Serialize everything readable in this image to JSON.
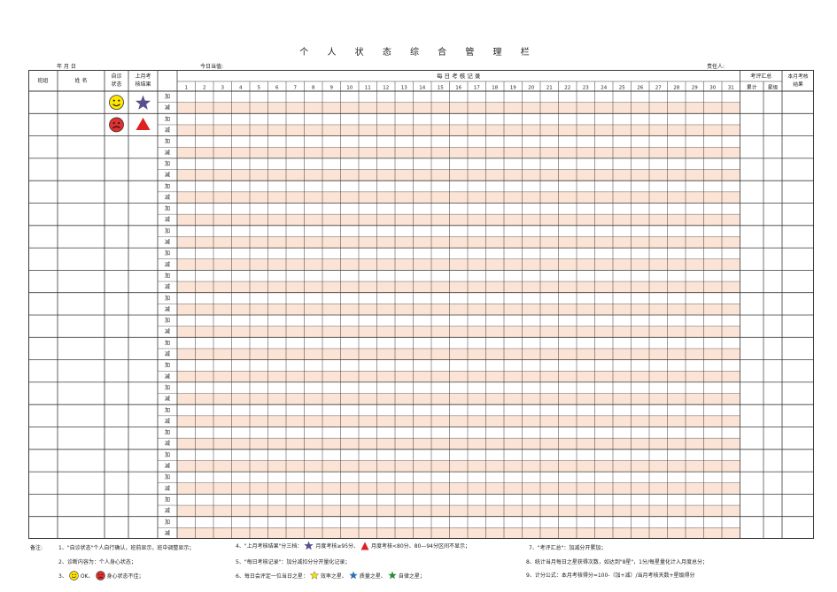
{
  "title": "个 人 状 态 综 合 管 理 栏",
  "header_meta": {
    "date_label": "年    月    日",
    "today_label": "今日当值:",
    "responsible_label": "责任人:"
  },
  "table": {
    "col_class": "班组",
    "col_name": "姓 名",
    "col_self_check": "自诊状态",
    "col_last_month": "上月考核结果",
    "col_daily": "每   日   考   核   记   录",
    "col_eval": "考评汇总",
    "col_total": "累计",
    "col_stars": "星级",
    "col_this_month": "本月考核结果",
    "day_numbers": [
      "1",
      "2",
      "3",
      "4",
      "5",
      "6",
      "7",
      "8",
      "9",
      "10",
      "11",
      "12",
      "13",
      "14",
      "15",
      "16",
      "17",
      "18",
      "19",
      "20",
      "21",
      "22",
      "23",
      "24",
      "25",
      "26",
      "27",
      "28",
      "29",
      "30",
      "31"
    ],
    "row_labels": [
      "加",
      "减"
    ],
    "person_rows": 20,
    "colors": {
      "border": "#3a3a3a",
      "shade": "#fbe4d5",
      "smile": "#ffe600",
      "sad": "#e03030",
      "star": "#5a4f8c",
      "triangle": "#e02020"
    }
  },
  "notes": {
    "label": "备注:",
    "n1": "1、\"自诊状态\"个人自行确认，班前显示，班中调整显示；",
    "n4a": "4、\"上月考核结果\"分三档：",
    "n4b": "月度考核≥95分、",
    "n4c": "月度考核<80分、80—94分区间不显示；",
    "n7": "7、\"考评汇总\"：加减分开累加；",
    "n2": "2、诊断内容为：个人身心状态；",
    "n5": "5、\"每日考核记录\"：加分减扣分分开量化记录；",
    "n8": "8、统计当月每日之星获得次数，如达到\"8星\"，1分/每星量化计入月度总分；",
    "n3a": "3、",
    "n3b": "OK、",
    "n3c": "身心状态不佳；",
    "n6a": "6、每日会评定一位当日之星：",
    "n6b": "效率之星、",
    "n6c": "质量之星、",
    "n6d": "自律之星；",
    "n9": "9、计分公式：本月考核得分=100-（加+减）/当月考核天数+星级得分"
  }
}
